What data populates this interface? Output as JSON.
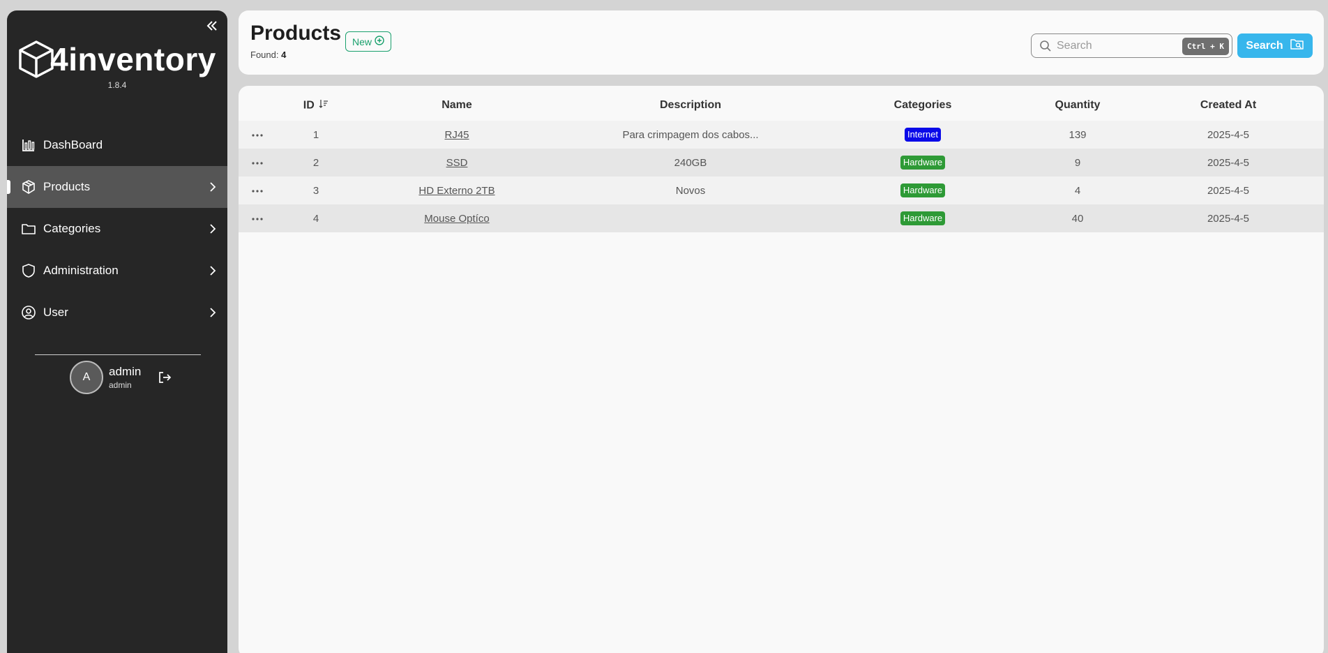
{
  "app": {
    "name": "4inventory",
    "version": "1.8.4"
  },
  "sidebar": {
    "items": [
      {
        "label": "DashBoard",
        "icon": "chart-bar-icon",
        "active": false,
        "chevron": false
      },
      {
        "label": "Products",
        "icon": "box-icon",
        "active": true,
        "chevron": true
      },
      {
        "label": "Categories",
        "icon": "folder-icon",
        "active": false,
        "chevron": true
      },
      {
        "label": "Administration",
        "icon": "shield-icon",
        "active": false,
        "chevron": true
      },
      {
        "label": "User",
        "icon": "user-circle-icon",
        "active": false,
        "chevron": true
      }
    ],
    "user": {
      "initial": "A",
      "name": "admin",
      "role": "admin"
    }
  },
  "header": {
    "title": "Products",
    "new_label": "New",
    "found_label": "Found:",
    "found_count": "4",
    "search": {
      "placeholder": "Search",
      "value": "",
      "shortcut": "Ctrl + K",
      "button_label": "Search"
    }
  },
  "table": {
    "columns": {
      "id": "ID",
      "name": "Name",
      "description": "Description",
      "categories": "Categories",
      "quantity": "Quantity",
      "created_at": "Created At"
    },
    "rows": [
      {
        "id": "1",
        "name": "RJ45",
        "description": "Para crimpagem dos cabos...",
        "category": "Internet",
        "category_color": "#0a0ae8",
        "quantity": "139",
        "created_at": "2025-4-5"
      },
      {
        "id": "2",
        "name": "SSD",
        "description": "240GB",
        "category": "Hardware",
        "category_color": "#2e9a36",
        "quantity": "9",
        "created_at": "2025-4-5"
      },
      {
        "id": "3",
        "name": "HD Externo 2TB",
        "description": "Novos",
        "category": "Hardware",
        "category_color": "#2e9a36",
        "quantity": "4",
        "created_at": "2025-4-5"
      },
      {
        "id": "4",
        "name": "Mouse Optíco",
        "description": "",
        "category": "Hardware",
        "category_color": "#2e9a36",
        "quantity": "40",
        "created_at": "2025-4-5"
      }
    ]
  },
  "colors": {
    "sidebar_bg": "#262626",
    "active_item_bg": "#555555",
    "accent_green": "#1aa06d",
    "search_button": "#37b6ec"
  }
}
